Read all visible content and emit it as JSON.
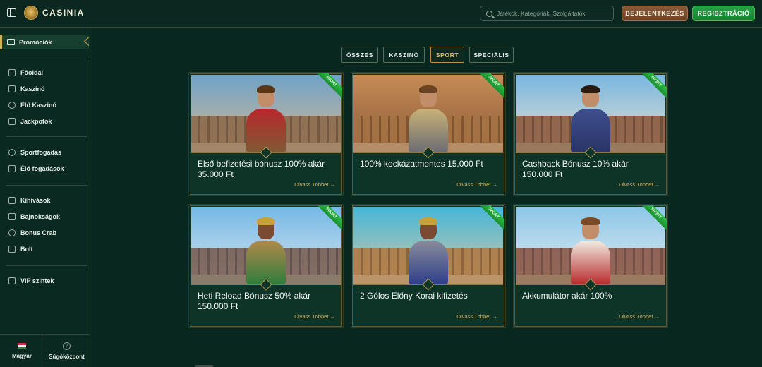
{
  "header": {
    "logo_text": "CASINIA",
    "search_placeholder": "Játékok, Kategóriák, Szolgáltatók",
    "login_label": "BEJELENTKEZÉS",
    "register_label": "REGISZTRÁCIÓ"
  },
  "sidebar": {
    "active": "Promóciók",
    "group1": [
      "Főoldal",
      "Kaszinó",
      "Élő Kaszinó",
      "Jackpotok"
    ],
    "group2": [
      "Sportfogadás",
      "Élő fogadások"
    ],
    "group3": [
      "Kihívások",
      "Bajnokságok",
      "Bonus Crab",
      "Bolt"
    ],
    "group4": [
      "VIP szintek"
    ],
    "language": "Magyar",
    "help": "Súgóközpont"
  },
  "filters": [
    {
      "label": "ÖSSZES",
      "active": false
    },
    {
      "label": "KASZINÓ",
      "active": false
    },
    {
      "label": "SPORT",
      "active": true
    },
    {
      "label": "SPECIÁLIS",
      "active": false
    }
  ],
  "badge_label": "SPORT",
  "read_more": "Olvass Többet →",
  "cards": [
    {
      "title": "Első befizetési bónusz 100% akár 35.000 Ft"
    },
    {
      "title": "100% kockázatmentes 15.000 Ft"
    },
    {
      "title": "Cashback Bónusz 10% akár 150.000 Ft"
    },
    {
      "title": "Heti Reload Bónusz 50% akár 150.000 Ft"
    },
    {
      "title": "2 Gólos Előny Korai kifizetés"
    },
    {
      "title": "Akkumulátor akár 100%"
    }
  ]
}
